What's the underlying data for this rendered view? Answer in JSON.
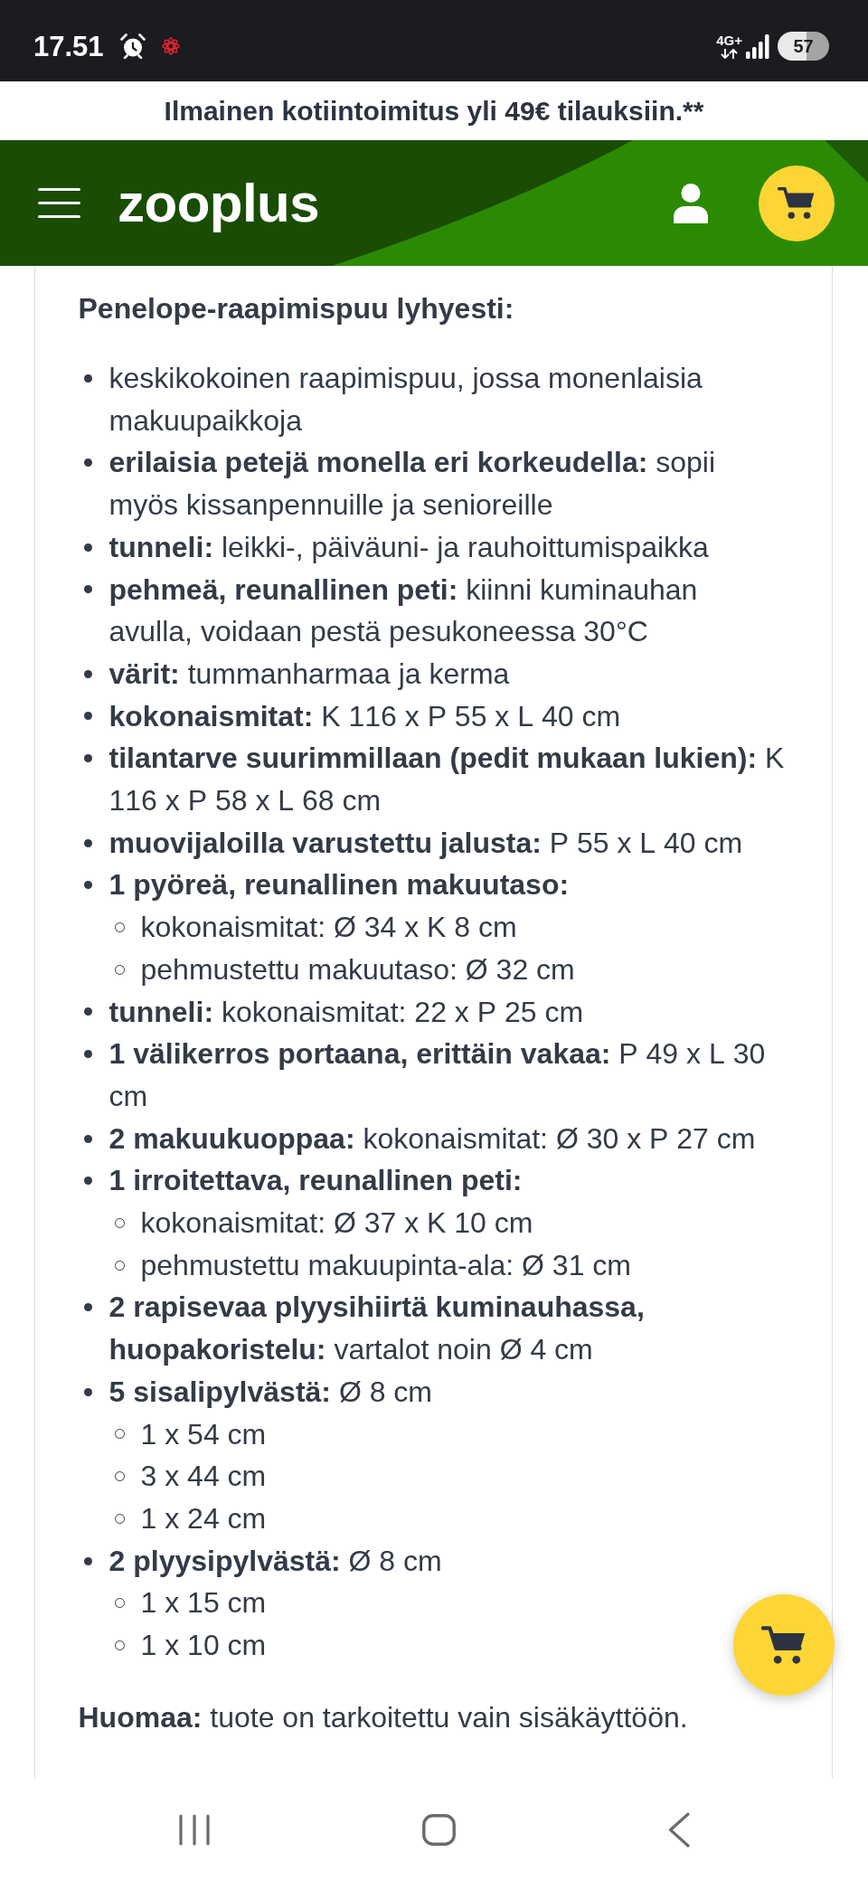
{
  "status_bar": {
    "time": "17.51",
    "network": "4G+",
    "battery": "57"
  },
  "promo_banner": {
    "text": "Ilmainen kotiintoimitus yli 49€ tilauksiin.**"
  },
  "header": {
    "logo": "zooplus"
  },
  "description": {
    "heading": "Penelope-raapimispuu lyhyesti:",
    "items": [
      {
        "text": "keskikokoinen raapimispuu, jossa monenlaisia makuupaikkoja"
      },
      {
        "text": "**erilaisia petejä monella eri korkeudella:** sopii myös kissanpennuille ja senioreille"
      },
      {
        "text": "**tunneli:** leikki-, päiväuni- ja rauhoittumispaikka"
      },
      {
        "text": "**pehmeä, reunallinen peti:** kiinni kuminauhan avulla, voidaan pestä pesukoneessa 30°C"
      },
      {
        "text": "**värit:** tummanharmaa ja kerma"
      },
      {
        "text": "**kokonaismitat:** K 116 x P 55 x L 40 cm"
      },
      {
        "text": "**tilantarve suurimmillaan (pedit mukaan lukien):** K 116 x P 58 x L 68 cm"
      },
      {
        "text": "**muovijaloilla varustettu jalusta:** P 55 x L 40 cm"
      },
      {
        "text": "**1 pyöreä, reunallinen makuutaso:**",
        "children": [
          {
            "text": "kokonaismitat: Ø 34 x K 8 cm"
          },
          {
            "text": "pehmustettu makuutaso: Ø 32 cm"
          }
        ]
      },
      {
        "text": "**tunneli:** kokonaismitat: 22 x P 25 cm"
      },
      {
        "text": "**1 välikerros portaana, erittäin vakaa:** P 49 x L 30 cm"
      },
      {
        "text": "**2 makuukuoppaa:** kokonaismitat: Ø 30 x P 27 cm"
      },
      {
        "text": "**1 irroitettava, reunallinen peti:**",
        "children": [
          {
            "text": "kokonaismitat: Ø 37 x K 10 cm"
          },
          {
            "text": "pehmustettu makuupinta-ala: Ø 31 cm"
          }
        ]
      },
      {
        "text": "**2 rapisevaa plyysihiirtä kuminauhassa, huopakoristelu:** vartalot noin Ø 4 cm"
      },
      {
        "text": "**5 sisalipylvästä:** Ø 8 cm",
        "children": [
          {
            "text": "1 x 54 cm"
          },
          {
            "text": "3 x 44 cm"
          },
          {
            "text": "1 x 24 cm"
          }
        ]
      },
      {
        "text": "**2 plyysipylvästä:** Ø 8 cm",
        "children": [
          {
            "text": "1 x 15 cm"
          },
          {
            "text": "1 x 10 cm"
          }
        ]
      }
    ],
    "note": "**Huomaa:** tuote on tarkoitettu vain sisäkäyttöön."
  }
}
